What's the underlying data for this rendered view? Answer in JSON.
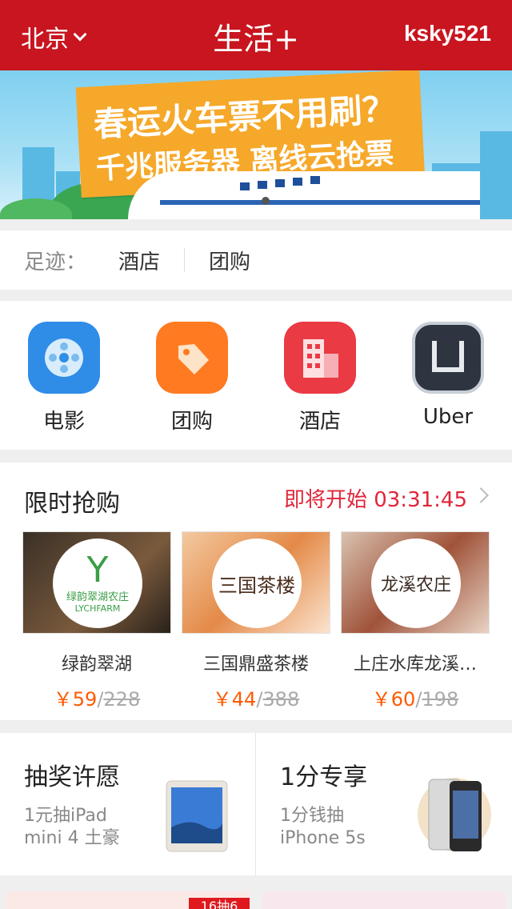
{
  "header": {
    "city": "北京",
    "title": "生活+",
    "user": "ksky521"
  },
  "banner": {
    "line1": "春运火车票不用刷？",
    "line2": "千兆服务器 离线云抢票"
  },
  "footprint": {
    "label": "足迹：",
    "items": [
      "酒店",
      "团购"
    ]
  },
  "categories": [
    {
      "label": "电影",
      "icon": "film-reel-icon",
      "color": "#2f8de8"
    },
    {
      "label": "团购",
      "icon": "price-tag-icon",
      "color": "#ff7a20"
    },
    {
      "label": "酒店",
      "icon": "hotel-building-icon",
      "color": "#ea3a44"
    },
    {
      "label": "Uber",
      "icon": "uber-logo-icon",
      "color": "#2e3540"
    }
  ],
  "flash_sale": {
    "title": "限时抢购",
    "status": "即将开始",
    "countdown": "03:31:45",
    "deals": [
      {
        "name": "绿韵翠湖",
        "price_now": "￥59",
        "sep": "/",
        "price_old": "228",
        "logo_text": "绿韵翠湖农庄",
        "logo_sub": "LYCHFARM"
      },
      {
        "name": "三国鼎盛茶楼",
        "price_now": "￥44",
        "sep": "/",
        "price_old": "388",
        "logo_text": "三国茶楼"
      },
      {
        "name": "上庄水库龙溪…",
        "price_now": "￥60",
        "sep": "/",
        "price_old": "198",
        "logo_text": "龙溪农庄"
      }
    ]
  },
  "promos": [
    {
      "title": "抽奖许愿",
      "sub1": "1元抽iPad",
      "sub2": "mini 4 土豪"
    },
    {
      "title": "1分专享",
      "sub1": "1分钱抽",
      "sub2": "iPhone 5s"
    }
  ],
  "bottom": {
    "badge": "16抽6"
  },
  "colors": {
    "brand": "#c8151f",
    "accent": "#ff5a00",
    "timer": "#e0263a"
  }
}
